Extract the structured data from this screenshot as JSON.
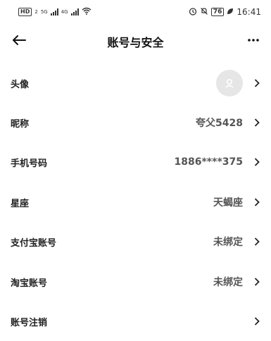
{
  "status_bar": {
    "left_badge": "HD",
    "left_badge_num": "2",
    "net1": "5G",
    "net2": "4G",
    "battery": "76",
    "time": "16:41"
  },
  "header": {
    "title": "账号与安全"
  },
  "rows": [
    {
      "label": "头像",
      "value": ""
    },
    {
      "label": "昵称",
      "value": "夸父5428"
    },
    {
      "label": "手机号码",
      "value": "1886****375"
    },
    {
      "label": "星座",
      "value": "天蝎座"
    },
    {
      "label": "支付宝账号",
      "value": "未绑定"
    },
    {
      "label": "淘宝账号",
      "value": "未绑定"
    },
    {
      "label": "账号注销",
      "value": ""
    }
  ],
  "colors": {
    "text": "#222222",
    "muted": "#555555",
    "avatar_bg": "#e6e6e6"
  }
}
